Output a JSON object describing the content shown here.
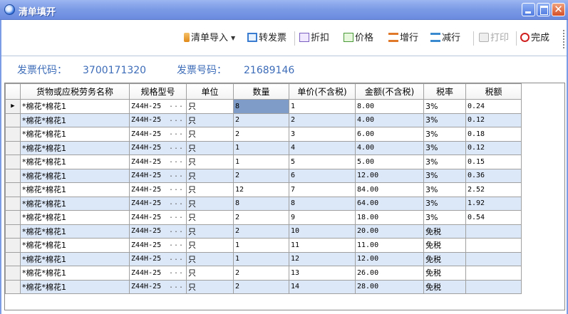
{
  "window": {
    "title": "清单填开",
    "minimize_icon": "minimize-icon",
    "maximize_icon": "maximize-icon",
    "close_icon": "close-icon",
    "close_glyph": "✕"
  },
  "toolbar": {
    "import_label": "清单导入",
    "transfer_label": "转发票",
    "discount_label": "折扣",
    "price_label": "价格",
    "add_row_label": "增行",
    "delete_row_label": "减行",
    "print_label": "打印",
    "done_label": "完成"
  },
  "invoice": {
    "code_label": "发票代码：",
    "code_value": "3700171320",
    "number_label": "发票号码：",
    "number_value": "21689146"
  },
  "grid": {
    "columns": [
      "货物或应税劳务名称",
      "规格型号",
      "单位",
      "数量",
      "单价(不含税)",
      "金额(不含税)",
      "税率",
      "税额"
    ],
    "current_row_marker": "▶",
    "spec_ellipsis": "...",
    "rows": [
      {
        "name": "*棉花*棉花1",
        "spec": "Z44H-25",
        "unit": "只",
        "qty": "8",
        "price": "1",
        "amount": "8.00",
        "rate": "3%",
        "tax": "0.24"
      },
      {
        "name": "*棉花*棉花1",
        "spec": "Z44H-25",
        "unit": "只",
        "qty": "2",
        "price": "2",
        "amount": "4.00",
        "rate": "3%",
        "tax": "0.12"
      },
      {
        "name": "*棉花*棉花1",
        "spec": "Z44H-25",
        "unit": "只",
        "qty": "2",
        "price": "3",
        "amount": "6.00",
        "rate": "3%",
        "tax": "0.18"
      },
      {
        "name": "*棉花*棉花1",
        "spec": "Z44H-25",
        "unit": "只",
        "qty": "1",
        "price": "4",
        "amount": "4.00",
        "rate": "3%",
        "tax": "0.12"
      },
      {
        "name": "*棉花*棉花1",
        "spec": "Z44H-25",
        "unit": "只",
        "qty": "1",
        "price": "5",
        "amount": "5.00",
        "rate": "3%",
        "tax": "0.15"
      },
      {
        "name": "*棉花*棉花1",
        "spec": "Z44H-25",
        "unit": "只",
        "qty": "2",
        "price": "6",
        "amount": "12.00",
        "rate": "3%",
        "tax": "0.36"
      },
      {
        "name": "*棉花*棉花1",
        "spec": "Z44H-25",
        "unit": "只",
        "qty": "12",
        "price": "7",
        "amount": "84.00",
        "rate": "3%",
        "tax": "2.52"
      },
      {
        "name": "*棉花*棉花1",
        "spec": "Z44H-25",
        "unit": "只",
        "qty": "8",
        "price": "8",
        "amount": "64.00",
        "rate": "3%",
        "tax": "1.92"
      },
      {
        "name": "*棉花*棉花1",
        "spec": "Z44H-25",
        "unit": "只",
        "qty": "2",
        "price": "9",
        "amount": "18.00",
        "rate": "3%",
        "tax": "0.54"
      },
      {
        "name": "*棉花*棉花1",
        "spec": "Z44H-25",
        "unit": "只",
        "qty": "2",
        "price": "10",
        "amount": "20.00",
        "rate": "免税",
        "tax": ""
      },
      {
        "name": "*棉花*棉花1",
        "spec": "Z44H-25",
        "unit": "只",
        "qty": "1",
        "price": "11",
        "amount": "11.00",
        "rate": "免税",
        "tax": ""
      },
      {
        "name": "*棉花*棉花1",
        "spec": "Z44H-25",
        "unit": "只",
        "qty": "1",
        "price": "12",
        "amount": "12.00",
        "rate": "免税",
        "tax": ""
      },
      {
        "name": "*棉花*棉花1",
        "spec": "Z44H-25",
        "unit": "只",
        "qty": "2",
        "price": "13",
        "amount": "26.00",
        "rate": "免税",
        "tax": ""
      },
      {
        "name": "*棉花*棉花1",
        "spec": "Z44H-25",
        "unit": "只",
        "qty": "2",
        "price": "14",
        "amount": "28.00",
        "rate": "免税",
        "tax": ""
      }
    ]
  },
  "colors": {
    "titlebar": "#7d9ce6",
    "label_blue": "#3d6cb8",
    "row_stripe": "#dce7f7",
    "selected_cell": "#7f9cc8"
  }
}
